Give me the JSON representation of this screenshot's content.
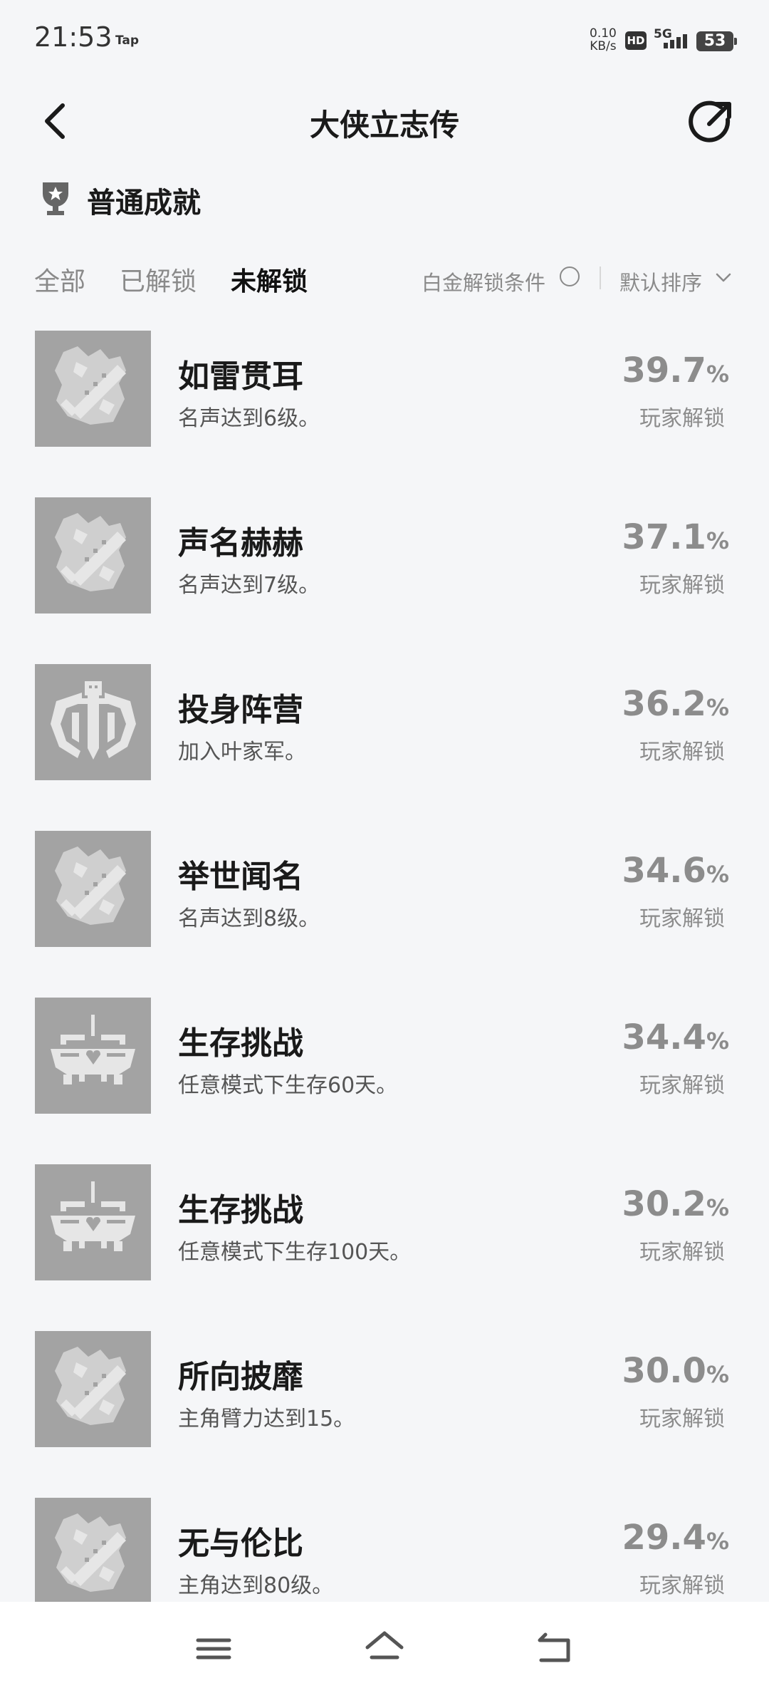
{
  "status_bar": {
    "time": "21:53",
    "app_indicator": "Tap",
    "net_speed_value": "0.10",
    "net_speed_unit": "KB/s",
    "hd": "HD",
    "network": "5G",
    "battery": "53"
  },
  "header": {
    "back_icon": "back-arrow-icon",
    "title": "大侠立志传",
    "share_icon": "share-icon"
  },
  "section": {
    "icon": "trophy-icon",
    "label": "普通成就"
  },
  "tabs": [
    {
      "label": "全部",
      "active": false
    },
    {
      "label": "已解锁",
      "active": false
    },
    {
      "label": "未解锁",
      "active": true
    }
  ],
  "filter": {
    "platinum_label": "白金解锁条件",
    "platinum_checked": false,
    "sort_label": "默认排序"
  },
  "achievements": [
    {
      "name": "如雷贯耳",
      "desc": "名声达到6级。",
      "percent": "39.7",
      "unit": "%",
      "caption": "玩家解锁",
      "icon": "sword-flame-icon"
    },
    {
      "name": "声名赫赫",
      "desc": "名声达到7级。",
      "percent": "37.1",
      "unit": "%",
      "caption": "玩家解锁",
      "icon": "sword-flame-icon"
    },
    {
      "name": "投身阵营",
      "desc": "加入叶家军。",
      "percent": "36.2",
      "unit": "%",
      "caption": "玩家解锁",
      "icon": "winged-sword-emblem-icon"
    },
    {
      "name": "举世闻名",
      "desc": "名声达到8级。",
      "percent": "34.6",
      "unit": "%",
      "caption": "玩家解锁",
      "icon": "sword-flame-icon"
    },
    {
      "name": "生存挑战",
      "desc": "任意模式下生存60天。",
      "percent": "34.4",
      "unit": "%",
      "caption": "玩家解锁",
      "icon": "heart-altar-icon"
    },
    {
      "name": "生存挑战",
      "desc": "任意模式下生存100天。",
      "percent": "30.2",
      "unit": "%",
      "caption": "玩家解锁",
      "icon": "heart-altar-icon"
    },
    {
      "name": "所向披靡",
      "desc": "主角臂力达到15。",
      "percent": "30.0",
      "unit": "%",
      "caption": "玩家解锁",
      "icon": "sword-flame-icon"
    },
    {
      "name": "无与伦比",
      "desc": "主角达到80级。",
      "percent": "29.4",
      "unit": "%",
      "caption": "玩家解锁",
      "icon": "sword-flame-icon"
    }
  ],
  "nav": {
    "menu_icon": "menu-icon",
    "home_icon": "home-icon",
    "back_icon": "return-icon"
  },
  "colors": {
    "background": "#f5f6f8",
    "icon_tile": "#a3a3a3",
    "icon_fg": "#e6e6e6",
    "muted_text": "#8c8c8c"
  }
}
